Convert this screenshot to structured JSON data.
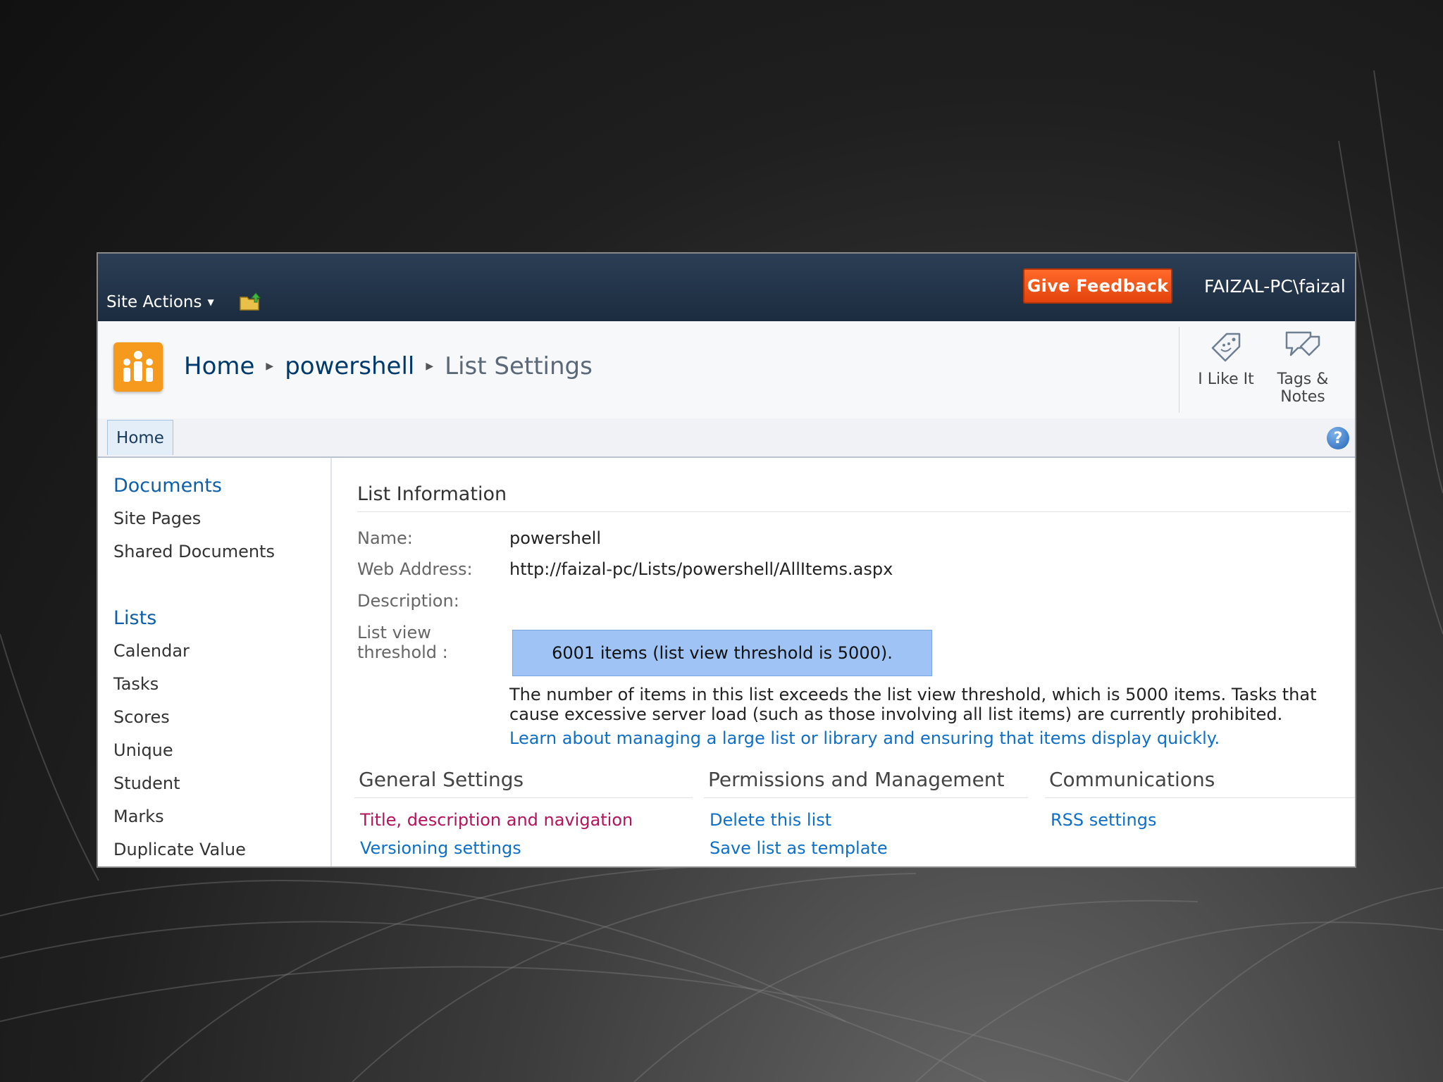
{
  "top_bar": {
    "site_actions_label": "Site Actions",
    "give_feedback_label": "Give Feedback",
    "user_name": "FAIZAL-PC\\faizal"
  },
  "breadcrumb": {
    "home": "Home",
    "site": "powershell",
    "current": "List Settings"
  },
  "social": {
    "like_label": "I Like It",
    "tags_label_line1": "Tags &",
    "tags_label_line2": "Notes"
  },
  "nav": {
    "home_tab": "Home",
    "help_glyph": "?"
  },
  "quick_launch": {
    "documents_heading": "Documents",
    "documents": [
      "Site Pages",
      "Shared Documents"
    ],
    "lists_heading": "Lists",
    "lists": [
      "Calendar",
      "Tasks",
      "Scores",
      "Unique",
      "Student",
      "Marks",
      "Duplicate Value"
    ]
  },
  "list_info": {
    "heading": "List Information",
    "name_label": "Name:",
    "name_value": "powershell",
    "web_address_label": "Web Address:",
    "web_address_value": "http://faizal-pc/Lists/powershell/AllItems.aspx",
    "description_label": "Description:",
    "threshold_label_line1": "List view",
    "threshold_label_line2": "threshold :",
    "threshold_status": "6001 items (list view threshold is 5000).",
    "threshold_message": "The number of items in this list exceeds the list view threshold, which is 5000 items. Tasks that cause excessive server load (such as those involving all list items) are currently prohibited.",
    "threshold_link": "Learn about managing a large list or library and ensuring that items display quickly."
  },
  "settings": {
    "general_heading": "General Settings",
    "general_links": [
      "Title, description and navigation",
      "Versioning settings"
    ],
    "permissions_heading": "Permissions and Management",
    "permissions_links": [
      "Delete this list",
      "Save list as template"
    ],
    "communications_heading": "Communications",
    "communications_links": [
      "RSS settings"
    ]
  },
  "colors": {
    "top_bar": "#1c2c40",
    "feedback_button": "#e3430c",
    "threshold_highlight": "#9ec3f4",
    "link": "#0e6fc7",
    "visited_link": "#b5125a"
  },
  "icons": {
    "folder_up": "upload-folder-icon",
    "site_logo": "people-site-icon",
    "like": "smiley-tag-icon",
    "tags_notes": "speech-tag-icon",
    "help": "help-icon"
  }
}
